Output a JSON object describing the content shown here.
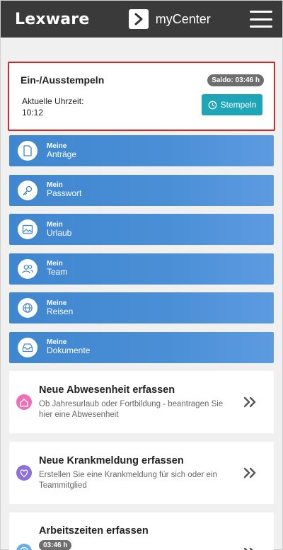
{
  "header": {
    "logo": "Lexware",
    "app_name": "myCenter"
  },
  "stamp": {
    "title": "Ein-/Ausstempeln",
    "saldo": "Saldo: 03:46 h",
    "time_label": "Aktuelle Uhrzeit:",
    "time_value": "10:12",
    "button_label": "Stempeln"
  },
  "nav": [
    {
      "small": "Meine",
      "big": "Anträge",
      "icon": "document-icon"
    },
    {
      "small": "Mein",
      "big": "Passwort",
      "icon": "key-icon"
    },
    {
      "small": "Mein",
      "big": "Urlaub",
      "icon": "image-icon"
    },
    {
      "small": "Mein",
      "big": "Team",
      "icon": "team-icon"
    },
    {
      "small": "Meine",
      "big": "Reisen",
      "icon": "globe-icon"
    },
    {
      "small": "Meine",
      "big": "Dokumente",
      "icon": "inbox-icon"
    }
  ],
  "actions": [
    {
      "title": "Neue Abwesenheit erfassen",
      "desc": "Ob Jahresurlaub oder Fortbildung - beantragen Sie hier eine Abwesenheit",
      "icon": "home-icon",
      "color": "#ee6fb5"
    },
    {
      "title": "Neue Krankmeldung erfassen",
      "desc": "Erstellen Sie eine Krankmeldung für sich oder ein Teammitglied",
      "icon": "heart-icon",
      "color": "#8f6fd8"
    },
    {
      "title": "Arbeitszeiten erfassen",
      "badge": "03:46 h",
      "icon": "clock-icon",
      "color": "#6aaee8"
    }
  ],
  "colors": {
    "header_bg": "#3a3a3a",
    "tile_blue": "#4a8fd6",
    "stamp_button": "#1fa5b8",
    "highlight_border": "#d62828"
  }
}
